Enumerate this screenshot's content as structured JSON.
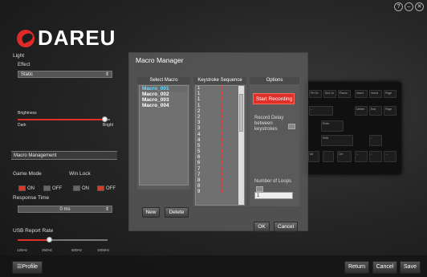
{
  "window": {
    "help": "?",
    "minimize": "–",
    "close": "✕"
  },
  "brand": {
    "name": "DAREU"
  },
  "light": {
    "title": "Light",
    "effect_label": "Effect",
    "effect_value": "Static",
    "brightness_label": "Brightness",
    "brightness_min": "Dark",
    "brightness_max": "Bright",
    "brightness_level": 0.95
  },
  "macro_management": {
    "label": "Macro Management"
  },
  "game_mode": {
    "label": "Game Mode",
    "on": "ON",
    "off": "OFF",
    "selected": "ON"
  },
  "win_lock": {
    "label": "Win Lock",
    "on": "ON",
    "off": "OFF",
    "selected": "OFF"
  },
  "response_time": {
    "label": "Response Time",
    "value": "0 ms"
  },
  "usb_report_rate": {
    "label": "USB Report Rate",
    "ticks": [
      "125Hz",
      "250Hz",
      "500Hz",
      "1000Hz"
    ],
    "selected": "250Hz"
  },
  "macro_manager": {
    "title": "Macro Manager",
    "select_macro_header": "Select Macro",
    "keystroke_header": "Keystroke Sequence",
    "options_header": "Options",
    "macros": [
      "Macro_001",
      "Macro_002",
      "Macro_003",
      "Macro_004"
    ],
    "selected_macro": "Macro_001",
    "sequence": [
      "1",
      "1",
      "1",
      "1",
      "2",
      "2",
      "3",
      "3",
      "4",
      "4",
      "5",
      "5",
      "6",
      "6",
      "7",
      "7",
      "8",
      "8",
      "9"
    ],
    "new_label": "New",
    "delete_label": "Delete",
    "start_recording": "Start Recording",
    "record_delay": "Record Delay between keystrokes",
    "loops_label": "Number of Loops",
    "loops_value": "1",
    "ok_label": "OK",
    "cancel_label": "Cancel"
  },
  "keyboard": {
    "keys": [
      "Prt Sc",
      "Scrl Lk",
      "Pause",
      "Insert",
      "Home",
      "Page",
      "Delete",
      "End",
      "Page",
      "Enter",
      "Shift",
      "F9",
      "F10",
      "F11",
      "F12",
      "Del",
      "Ins",
      "Alt",
      "Ctrl"
    ]
  },
  "footer": {
    "profile_label": "Profile",
    "return_label": "Return",
    "cancel_label": "Cancel",
    "save_label": "Save"
  }
}
